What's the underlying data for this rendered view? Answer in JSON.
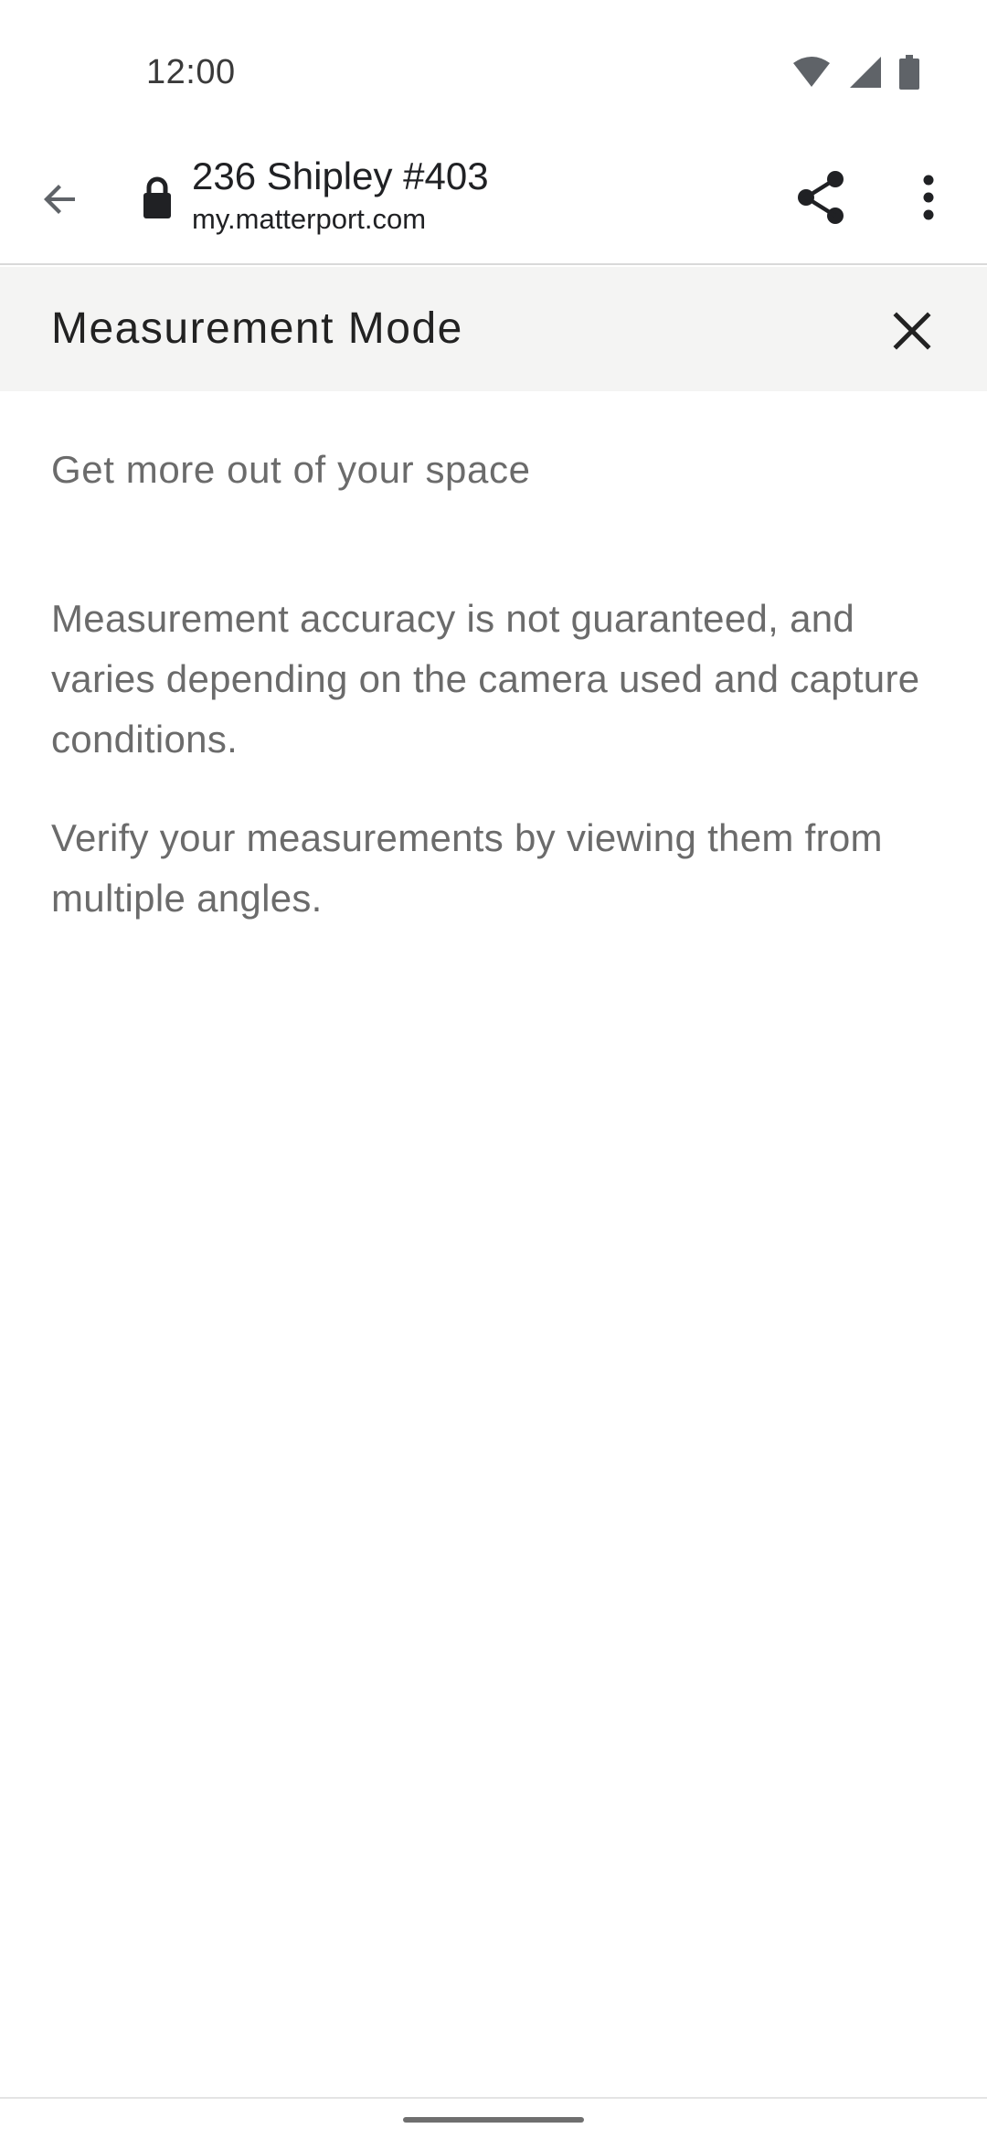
{
  "status_bar": {
    "time": "12:00",
    "icons": [
      "wifi-icon",
      "cellular-signal-icon",
      "battery-icon"
    ]
  },
  "toolbar": {
    "page_title": "236 Shipley #403",
    "url": "my.matterport.com",
    "icons": [
      "arrow-back-icon",
      "lock-icon",
      "share-icon",
      "more-vert-icon"
    ]
  },
  "mode_panel": {
    "title": "Measurement Mode",
    "close_icon": "close-icon",
    "intro": "Get more out of your space",
    "paragraphs": [
      "Measurement accuracy is not guaranteed, and varies depending on the camera used and capture conditions.",
      "Verify your measurements by viewing them from multiple angles."
    ]
  },
  "colors": {
    "header_bg": "#f4f4f3",
    "body_text": "#6b6b6b",
    "title_text": "#222222"
  }
}
